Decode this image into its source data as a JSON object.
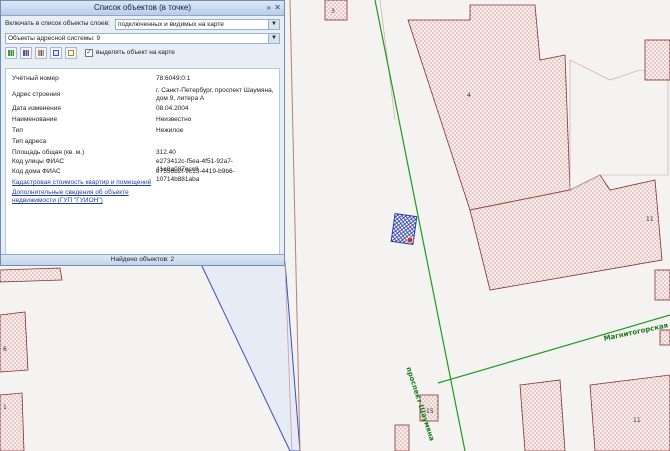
{
  "panel": {
    "title": "Список объектов (в точке)",
    "layers_label": "Включать в список объекты слоев:",
    "layers_value": "подключенных и видимых на карте",
    "system_value": "Объекты адресной системы: 9",
    "highlight_label": "выделять объект на карте",
    "properties": [
      {
        "key": "Учётный номер",
        "value": "78:6049:0:1"
      },
      {
        "key": "Адрес строения",
        "value": "г. Санкт-Петербург, проспект Шаумяна, дом 9, литера А"
      },
      {
        "key": "Дата изменения",
        "value": "08.04.2004"
      },
      {
        "key": "Наименование",
        "value": "Неизвестно"
      },
      {
        "key": "Тип",
        "value": "Нежилое"
      },
      {
        "key": "Тип адреса",
        "value": ""
      },
      {
        "key": "Площадь общая (кв. м.)",
        "value": "312.40"
      },
      {
        "key": "Код улицы ФИАС",
        "value": "e273412c-f5ea-4f51-92a7-41e8a087ecc8"
      },
      {
        "key": "Код дома ФИАС",
        "value": "e7556b2f-9c13-4419-b9b6-10714b881aba"
      }
    ],
    "links": [
      "Кадастровая стоимость квартир и помещений",
      "Дополнительные сведения об объекте недвижимости (ГУП \"ГУИОН\")"
    ],
    "footer": "Найдено объектов: 2"
  },
  "map": {
    "labels": {
      "b3": "3",
      "b4": "4",
      "b11a": "11",
      "b11b": "11",
      "b15": "15",
      "b6": "6",
      "b1": "1"
    },
    "streets": {
      "prospekt": "проспект Шаумяна",
      "magnitogorskaya": "Магнитогорская"
    }
  }
}
